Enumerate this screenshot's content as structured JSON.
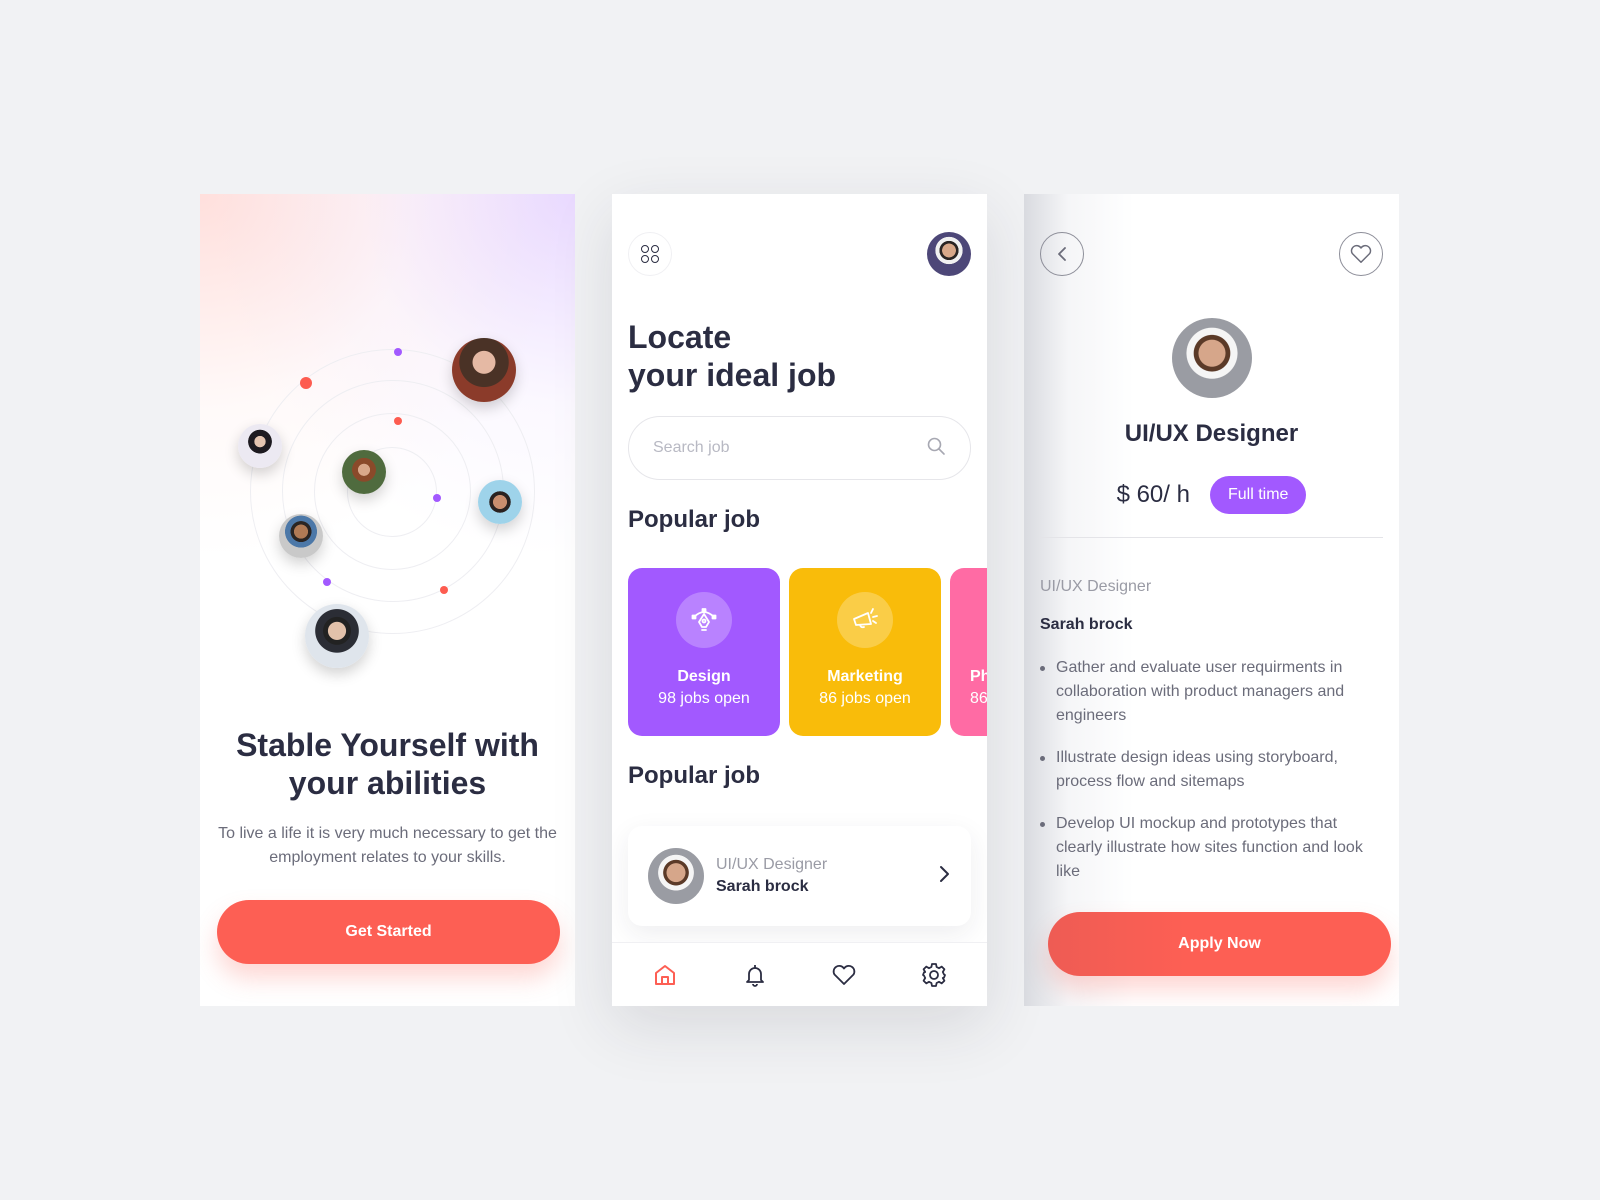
{
  "colors": {
    "background": "#f1f2f4",
    "primary_coral": "#fd5f54",
    "accent_purple": "#a259ff",
    "accent_yellow": "#f9bc0a",
    "accent_pink": "#ff6ba4",
    "text_dark": "#2b2d42",
    "text_muted": "#6b6c7a"
  },
  "onboarding": {
    "title": "Stable Yourself with your abilities",
    "subtitle": "To live a life it is very much necessary to get the employment relates to your skills.",
    "cta_label": "Get Started",
    "avatars": [
      "avatar-woman-glasses",
      "avatar-woman-dark-hair",
      "avatar-bearded-man",
      "avatar-smiling-woman",
      "avatar-smiling-man",
      "avatar-man-glasses"
    ]
  },
  "home": {
    "menu_icon": "grid-menu-icon",
    "profile_avatar": "user-avatar",
    "title_line1": "Locate",
    "title_line2": "your ideal job",
    "search": {
      "placeholder": "Search job",
      "value": "",
      "icon": "search-icon"
    },
    "popular_heading": "Popular job",
    "categories": [
      {
        "name": "Design",
        "count": "98 jobs open",
        "icon": "pen-tool-icon",
        "color": "#a259ff"
      },
      {
        "name": "Marketing",
        "count": "86 jobs open",
        "icon": "megaphone-icon",
        "color": "#f9bc0a"
      },
      {
        "name": "Ph",
        "count": "86",
        "icon": "camera-icon",
        "color": "#ff6ba4"
      }
    ],
    "popular_heading_2": "Popular job",
    "job": {
      "role": "UI/UX Designer",
      "name": "Sarah brock"
    },
    "nav": [
      {
        "label": "Home",
        "icon": "home-icon",
        "active": true
      },
      {
        "label": "Notifications",
        "icon": "bell-icon",
        "active": false
      },
      {
        "label": "Favorites",
        "icon": "heart-icon",
        "active": false
      },
      {
        "label": "Settings",
        "icon": "gear-icon",
        "active": false
      }
    ]
  },
  "detail": {
    "title": "UI/UX Designer",
    "price": "$ 60/ h",
    "badge": "Full time",
    "role": "UI/UX Designer",
    "name": "Sarah brock",
    "bullets": [
      "Gather and evaluate user requirments in collaboration with product managers and engineers",
      "Illustrate design ideas using storyboard, process flow and sitemaps",
      "Develop UI mockup and prototypes that clearly illustrate how sites function and look like"
    ],
    "cta_label": "Apply Now"
  }
}
